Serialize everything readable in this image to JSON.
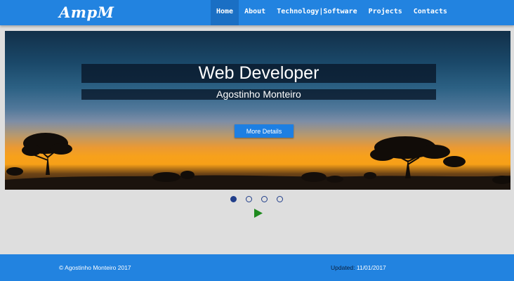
{
  "navbar": {
    "logo": "AmpM",
    "items": [
      {
        "label": "Home",
        "active": true
      },
      {
        "label": "About",
        "active": false
      },
      {
        "label": "Technology|Software",
        "active": false
      },
      {
        "label": "Projects",
        "active": false
      },
      {
        "label": "Contacts",
        "active": false
      }
    ],
    "bg_color": "#2283e0"
  },
  "hero": {
    "title": "Web Developer",
    "subtitle": "Agostinho Monteiro",
    "button_label": "More Details"
  },
  "carousel": {
    "slide_count": 4,
    "active_slide": 1,
    "play_icon": "play-icon",
    "play_color": "#1e8a1e"
  },
  "footer": {
    "copyright": "© Agostinho Monteiro 2017",
    "updated_label": "Updated:",
    "updated_date": "11/01/2017"
  }
}
